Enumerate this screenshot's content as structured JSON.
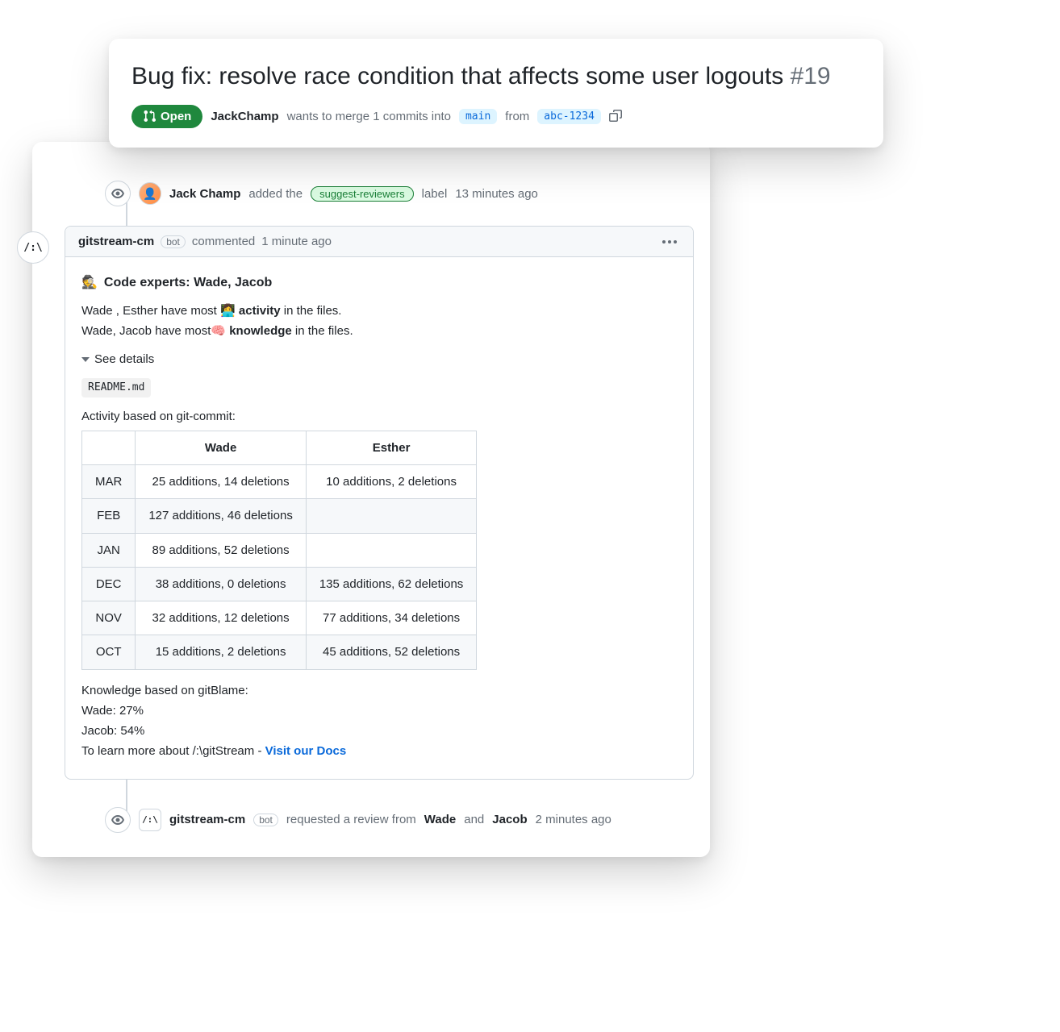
{
  "header": {
    "title": "Bug fix: resolve race condition that affects some user logouts",
    "number": "#19",
    "state": "Open",
    "author": "JackChamp",
    "merge_text_1": "wants to merge 1 commits into",
    "base_branch": "main",
    "from_text": "from",
    "head_branch": "abc-1234"
  },
  "event_label": {
    "user": "Jack Champ",
    "action": "added the",
    "label": "suggest-reviewers",
    "suffix": "label",
    "time": "13 minutes ago"
  },
  "comment": {
    "author": "gitstream-cm",
    "bot_badge": "bot",
    "action": "commented",
    "time": "1 minute ago",
    "avatar_glyph": "/:\\",
    "heading": "Code experts: Wade, Jacob",
    "activity_line_prefix": "Wade , Esther have most",
    "activity_word": "activity",
    "activity_line_suffix": "in the files.",
    "knowledge_line_prefix": "Wade, Jacob have most",
    "knowledge_word": "knowledge",
    "knowledge_line_suffix": "in the files.",
    "details_toggle": "See details",
    "file": "README.md",
    "activity_caption": "Activity based on git-commit:",
    "table_headers": [
      "",
      "Wade",
      "Esther"
    ],
    "table_rows": [
      [
        "MAR",
        "25 additions, 14 deletions",
        "10 additions, 2 deletions"
      ],
      [
        "FEB",
        "127 additions, 46 deletions",
        ""
      ],
      [
        "JAN",
        "89 additions, 52 deletions",
        ""
      ],
      [
        "DEC",
        "38 additions, 0 deletions",
        "135 additions, 62 deletions"
      ],
      [
        "NOV",
        "32 additions, 12 deletions",
        "77 additions, 34 deletions"
      ],
      [
        "OCT",
        "15 additions, 2 deletions",
        "45 additions, 52 deletions"
      ]
    ],
    "knowledge_caption": "Knowledge based on gitBlame:",
    "knowledge_rows": [
      "Wade: 27%",
      "Jacob: 54%"
    ],
    "learn_prefix": "To learn more about /:\\gitStream -",
    "learn_link": "Visit our Docs"
  },
  "event_review": {
    "author": "gitstream-cm",
    "bot_badge": "bot",
    "action_prefix": "requested a review from",
    "reviewer1": "Wade",
    "and": "and",
    "reviewer2": "Jacob",
    "time": "2 minutes ago",
    "avatar_glyph": "/:\\"
  }
}
